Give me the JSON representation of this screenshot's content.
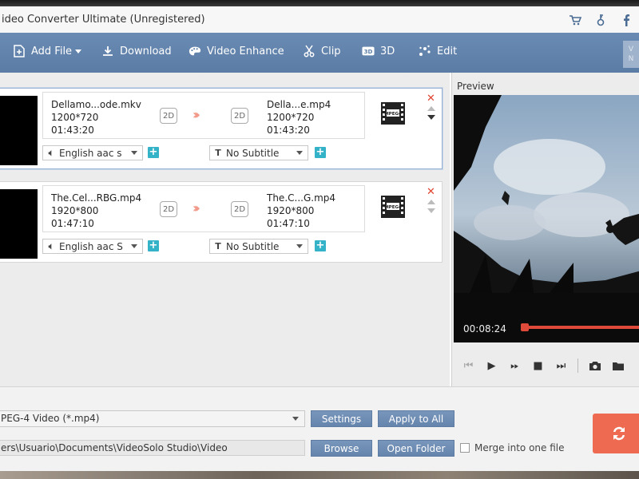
{
  "window": {
    "title": "ideo Converter Ultimate (Unregistered)",
    "title_icons": [
      "cart-icon",
      "key-icon",
      "facebook-icon"
    ]
  },
  "toolbar": {
    "add_file": "Add File",
    "download": "Download",
    "video_enhance": "Video Enhance",
    "clip": "Clip",
    "three_d": "3D",
    "edit": "Edit",
    "vip_label": "V\nN"
  },
  "files": [
    {
      "source_name": "Dellamo...ode.mkv",
      "source_res": "1200*720",
      "source_duration": "01:43:20",
      "source_mode": "2D",
      "target_mode": "2D",
      "target_name": "Della...e.mp4",
      "target_res": "1200*720",
      "target_duration": "01:43:20",
      "audio": "English aac s",
      "subtitle": "No Subtitle",
      "format_icon": "mpeg4-film-icon",
      "selected": true
    },
    {
      "source_name": "The.Cel...RBG.mp4",
      "source_res": "1920*800",
      "source_duration": "01:47:10",
      "source_mode": "2D",
      "target_mode": "2D",
      "target_name": "The.C...G.mp4",
      "target_res": "1920*800",
      "target_duration": "01:47:10",
      "audio": "English aac S",
      "subtitle": "No Subtitle",
      "format_icon": "mpeg4-film-icon",
      "selected": false
    }
  ],
  "preview": {
    "label": "Preview",
    "time": "00:08:24",
    "progress": 0.04
  },
  "bottom": {
    "profile": "PEG-4 Video (*.mp4)",
    "settings": "Settings",
    "apply_to_all": "Apply to All",
    "destination": "ers\\Usuario\\Documents\\VideoSolo Studio\\Video",
    "browse": "Browse",
    "open_folder": "Open Folder",
    "merge": "Merge into one file",
    "merge_checked": false
  },
  "colors": {
    "toolbar": "#5f80a9",
    "accent_button": "#6f8db4",
    "convert": "#ee6b52",
    "plus": "#34b3c8",
    "remove": "#e0442e",
    "seek": "#e04a3a"
  }
}
